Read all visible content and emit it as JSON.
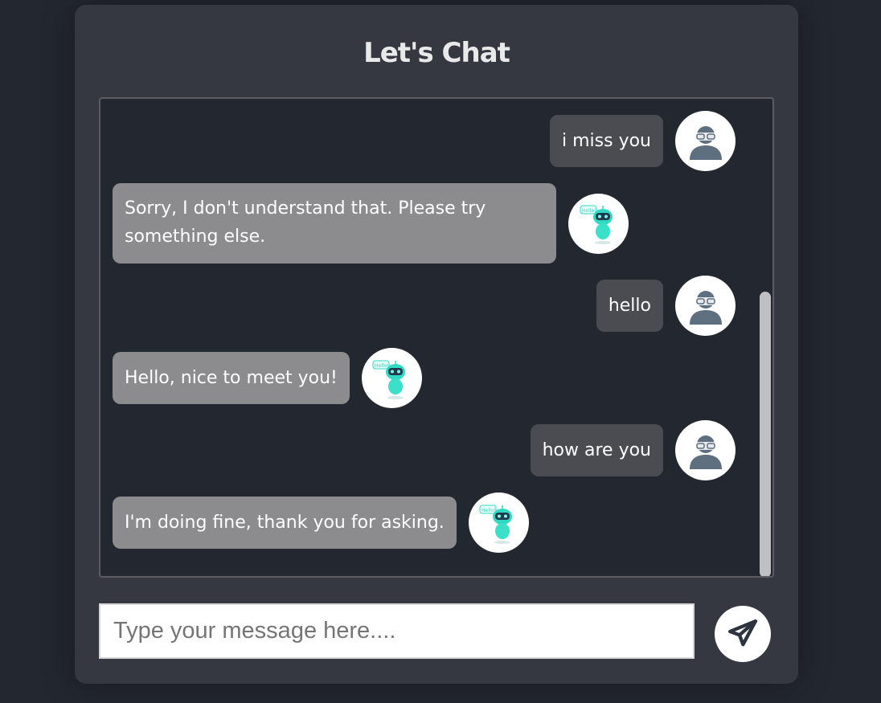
{
  "header": {
    "title": "Let's Chat"
  },
  "messages": [
    {
      "sender": "user",
      "text": "i miss you"
    },
    {
      "sender": "bot",
      "text": "Sorry, I don't understand that. Please try something else."
    },
    {
      "sender": "user",
      "text": "hello"
    },
    {
      "sender": "bot",
      "text": "Hello, nice to meet you!"
    },
    {
      "sender": "user",
      "text": "how are you"
    },
    {
      "sender": "bot",
      "text": "I'm doing fine, thank you for asking."
    }
  ],
  "composer": {
    "placeholder": "Type your message here....",
    "value": ""
  },
  "icons": {
    "user_avatar": "user-avatar-icon",
    "bot_avatar": "robot-avatar-icon",
    "send": "paper-plane-icon"
  },
  "colors": {
    "page_background": "#23272f",
    "card_background": "#353840",
    "user_bubble": "#4b4c52",
    "bot_bubble": "#8c8c8f",
    "bot_accent": "#2fd9c2"
  },
  "robot_speech_label": "Hello!"
}
